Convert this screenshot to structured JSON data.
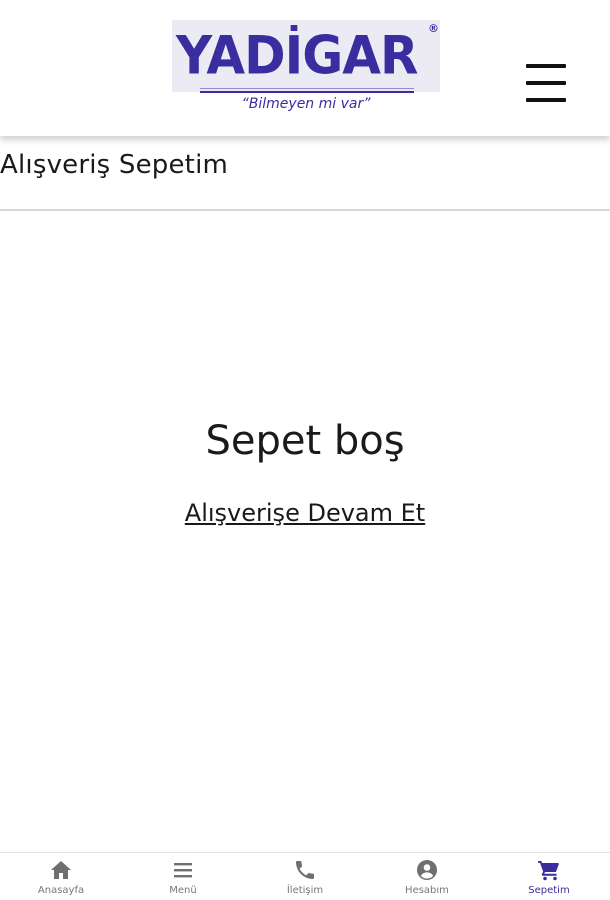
{
  "header": {
    "logo": {
      "brand": "YADİGAR",
      "registered": "®",
      "tagline": "“Bilmeyen mi var”"
    },
    "menu_icon": "hamburger-icon"
  },
  "page": {
    "title": "Alışveriş Sepetim",
    "empty_message": "Sepet boş",
    "continue_link": "Alışverişe Devam Et"
  },
  "bottom_nav": {
    "accent_color": "#3a2da0",
    "items": [
      {
        "label": "Anasayfa",
        "icon": "home-icon",
        "active": false
      },
      {
        "label": "Menü",
        "icon": "menu-icon",
        "active": false
      },
      {
        "label": "İletişim",
        "icon": "phone-icon",
        "active": false
      },
      {
        "label": "Hesabım",
        "icon": "account-icon",
        "active": false
      },
      {
        "label": "Sepetim",
        "icon": "cart-icon",
        "active": true
      }
    ]
  }
}
